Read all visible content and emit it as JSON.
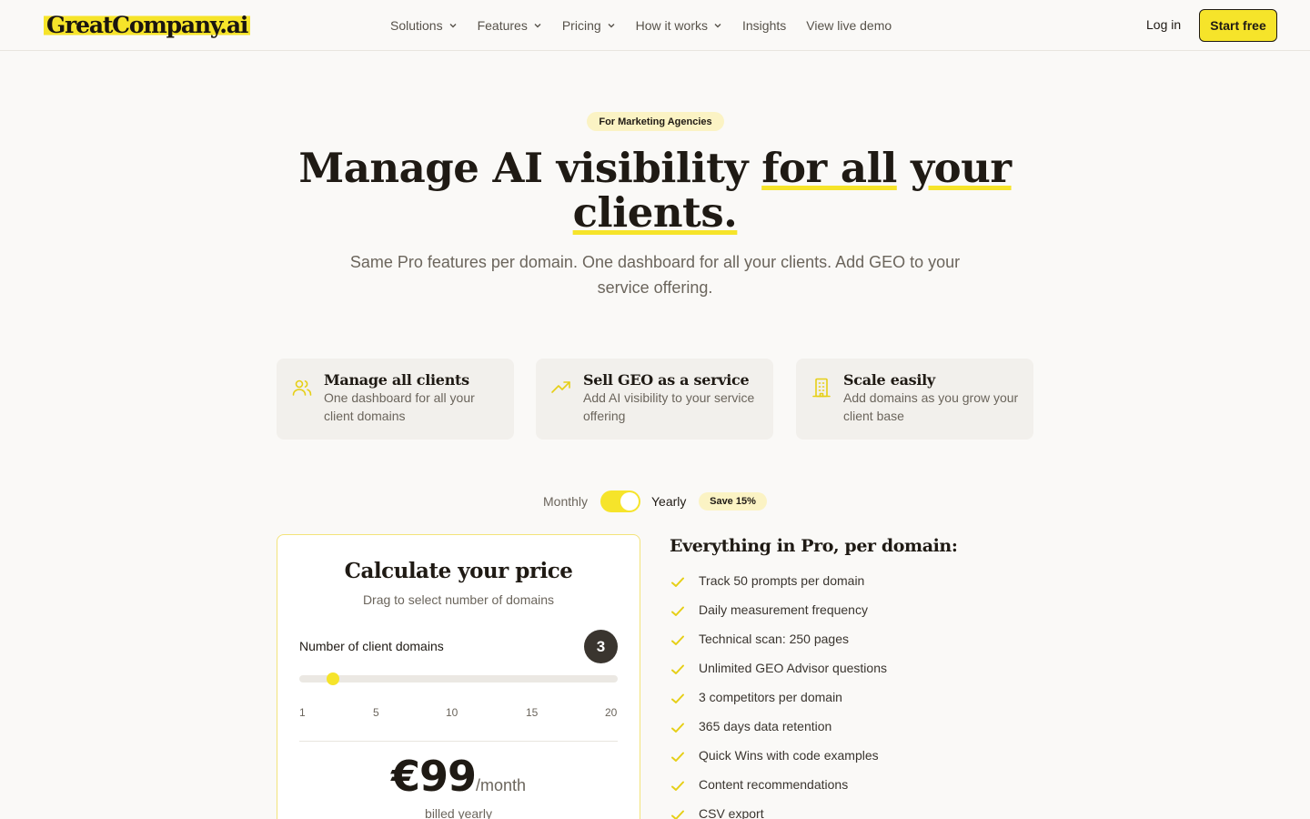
{
  "brand": {
    "name": "GreatCompany.ai",
    "accent": "#f6e42a",
    "dark": "#1f1a14"
  },
  "nav": {
    "items": [
      {
        "label": "Solutions",
        "dropdown": true
      },
      {
        "label": "Features",
        "dropdown": true
      },
      {
        "label": "Pricing",
        "dropdown": true
      },
      {
        "label": "How it works",
        "dropdown": true
      },
      {
        "label": "Insights",
        "dropdown": false
      },
      {
        "label": "View live demo",
        "dropdown": false
      }
    ],
    "login": "Log in",
    "cta": "Start free"
  },
  "hero": {
    "badge": "For Marketing Agencies",
    "title_part1": "Manage AI visibility ",
    "title_highlight1": "for all",
    "title_space": " ",
    "title_highlight2": "your",
    "title_highlight3": "clients.",
    "subtitle": "Same Pro features per domain. One dashboard for all your clients. Add GEO to your service offering."
  },
  "benefits": [
    {
      "icon": "users-icon",
      "title": "Manage all clients",
      "desc": "One dashboard for all your client domains"
    },
    {
      "icon": "trending-up-icon",
      "title": "Sell GEO as a service",
      "desc": "Add AI visibility to your service offering"
    },
    {
      "icon": "building-icon",
      "title": "Scale easily",
      "desc": "Add domains as you grow your client base"
    }
  ],
  "billing": {
    "monthly": "Monthly",
    "yearly": "Yearly",
    "save": "Save 15%",
    "yearly_selected": true
  },
  "calculator": {
    "title": "Calculate your price",
    "subtitle": "Drag to select number of domains",
    "domains_label": "Number of client domains",
    "domains_value": "3",
    "slider": {
      "min": 1,
      "max": 20,
      "value": 3
    },
    "ticks": [
      "1",
      "5",
      "10",
      "15",
      "20"
    ],
    "price": "€99",
    "per": "/month",
    "billed": "billed yearly"
  },
  "features": {
    "title": "Everything in Pro, per domain:",
    "items": [
      "Track 50 prompts per domain",
      "Daily measurement frequency",
      "Technical scan: 250 pages",
      "Unlimited GEO Advisor questions",
      "3 competitors per domain",
      "365 days data retention",
      "Quick Wins with code examples",
      "Content recommendations",
      "CSV export"
    ]
  }
}
